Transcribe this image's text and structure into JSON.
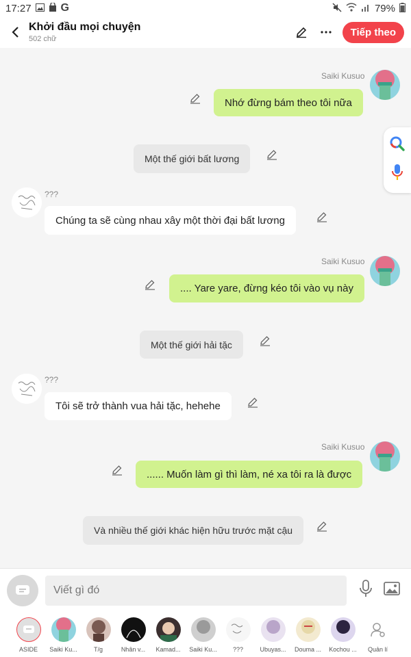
{
  "status": {
    "time": "17:27",
    "battery": "79%",
    "left_icons": [
      "image-icon",
      "bag-icon",
      "google-icon"
    ],
    "right_icons": [
      "mute-icon",
      "wifi-icon",
      "signal-icon",
      "battery-icon"
    ]
  },
  "header": {
    "title": "Khởi đầu mọi chuyện",
    "subtitle": "502 chữ",
    "next_label": "Tiếp theo"
  },
  "messages": [
    {
      "type": "right",
      "name": "Saiki Kusuo",
      "text": "Nhớ đừng bám theo tôi nữa"
    },
    {
      "type": "narration",
      "text": "Một thế giới bất lương"
    },
    {
      "type": "left",
      "name": "???",
      "text": "Chúng ta sẽ cùng nhau xây một thời đại bất lương"
    },
    {
      "type": "right",
      "name": "Saiki Kusuo",
      "text": ".... Yare yare, đừng kéo tôi vào vụ này"
    },
    {
      "type": "narration",
      "text": "Một thế giới hải tặc"
    },
    {
      "type": "left",
      "name": "???",
      "text": "Tôi sẽ trở thành vua hải tặc, hehehe"
    },
    {
      "type": "right",
      "name": "Saiki Kusuo",
      "text": "...... Muốn làm gì thì làm, né xa tôi ra là được"
    },
    {
      "type": "narration",
      "text": "Và nhiều thế giới khác hiện hữu trước mặt cậu"
    }
  ],
  "input": {
    "placeholder": "Viết gì đó"
  },
  "characters": [
    {
      "label": "ASIDE",
      "color": "#e0e0e0"
    },
    {
      "label": "Saiki Ku...",
      "color": "#e3708a"
    },
    {
      "label": "T/g",
      "color": "#7a5a52"
    },
    {
      "label": "Nhân v...",
      "color": "#111111"
    },
    {
      "label": "Kamad...",
      "color": "#3b2f2f"
    },
    {
      "label": "Saiki Ku...",
      "color": "#cfcfcf"
    },
    {
      "label": "???",
      "color": "#eeeeee"
    },
    {
      "label": "Ubuyas...",
      "color": "#b9a5c9"
    },
    {
      "label": "Douma ...",
      "color": "#e6d8a8"
    },
    {
      "label": "Kochou ...",
      "color": "#2c2440"
    },
    {
      "label": "Quản lí",
      "color": "#ffffff"
    }
  ],
  "colors": {
    "accent": "#f2434b",
    "user_bubble": "#d1f28f",
    "other_bubble": "#ffffff",
    "narration_bubble": "#e8e8e8"
  }
}
